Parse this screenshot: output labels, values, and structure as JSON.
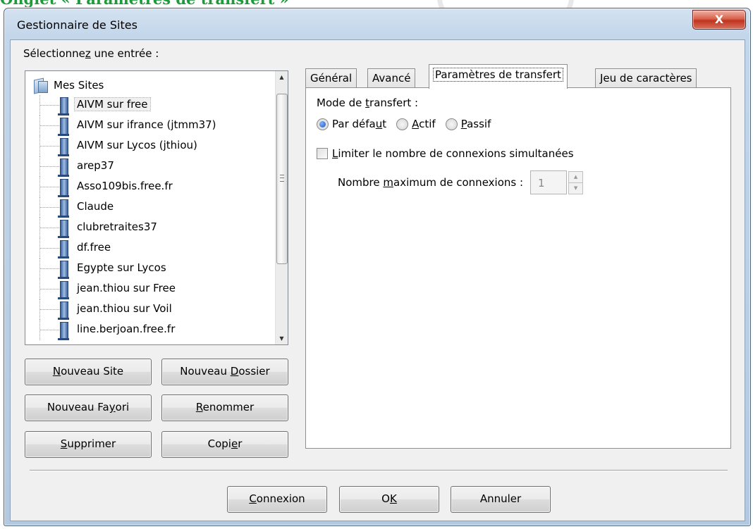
{
  "heading": "Onglet « Paramètres de transfert »",
  "window": {
    "title": "Gestionnaire de Sites",
    "close_label": "X"
  },
  "sites": {
    "select_label": "Sélectionnez une entrée :",
    "root": "Mes Sites",
    "items": [
      {
        "name": "AIVM sur free"
      },
      {
        "name": "AIVM sur ifrance (jtmm37)"
      },
      {
        "name": "AIVM sur Lycos (jthiou)"
      },
      {
        "name": "arep37"
      },
      {
        "name": "Asso109bis.free.fr"
      },
      {
        "name": "Claude"
      },
      {
        "name": "clubretraites37"
      },
      {
        "name": "df.free"
      },
      {
        "name": "Egypte sur Lycos"
      },
      {
        "name": "jean.thiou sur Free"
      },
      {
        "name": "jean.thiou sur Voil"
      },
      {
        "name": "line.berjoan.free.fr"
      }
    ]
  },
  "buttons": {
    "new_site": {
      "u": "N",
      "rest": "ouveau Site"
    },
    "new_folder": {
      "pre": "Nouveau ",
      "u": "D",
      "rest": "ossier"
    },
    "new_favorite": {
      "pre": "Nouveau Fa",
      "u": "y",
      "rest": "ori"
    },
    "rename": {
      "u": "R",
      "rest": "enommer"
    },
    "delete": {
      "u": "S",
      "rest": "upprimer"
    },
    "copy": {
      "pre": "Copi",
      "u": "e",
      "rest": "r"
    },
    "connect": {
      "u": "C",
      "rest": "onnexion"
    },
    "ok": {
      "pre": "O",
      "u": "K"
    },
    "cancel": "Annuler"
  },
  "tabs": [
    "Général",
    "Avancé",
    "Paramètres de transfert",
    "Jeu de caractères"
  ],
  "transfer": {
    "mode_label_pre": "Mode de ",
    "mode_label_u": "t",
    "mode_label_rest": "ransfert :",
    "options": [
      {
        "pre": "Par défa",
        "u": "u",
        "rest": "t",
        "selected": true
      },
      {
        "pre": "",
        "u": "A",
        "rest": "ctif",
        "selected": false
      },
      {
        "pre": "",
        "u": "P",
        "rest": "assif",
        "selected": false
      }
    ],
    "limit_u": "L",
    "limit_rest": "imiter le nombre de connexions simultanées",
    "limit_checked": false,
    "max_pre": "Nombre ",
    "max_u": "m",
    "max_rest": "aximum de connexions :",
    "max_value": "1"
  }
}
